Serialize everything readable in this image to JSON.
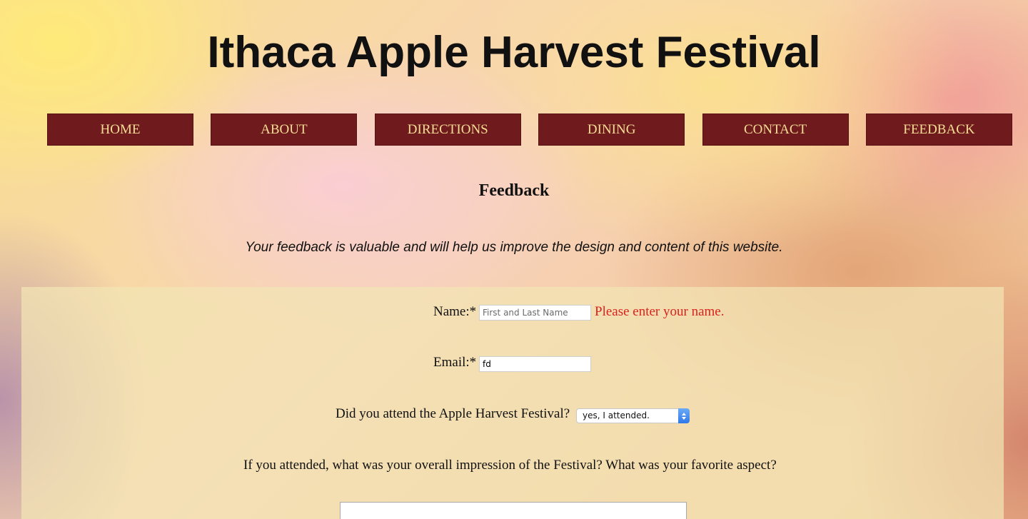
{
  "site": {
    "title": "Ithaca Apple Harvest Festival"
  },
  "nav": {
    "items": [
      {
        "label": "HOME"
      },
      {
        "label": "ABOUT"
      },
      {
        "label": "DIRECTIONS"
      },
      {
        "label": "DINING"
      },
      {
        "label": "CONTACT"
      },
      {
        "label": "FEEDBACK"
      }
    ]
  },
  "page": {
    "heading": "Feedback",
    "intro": "Your feedback is valuable and will help us improve the design and content of this website."
  },
  "form": {
    "name": {
      "label": "Name:*",
      "placeholder": "First and Last Name",
      "value": "",
      "error": "Please enter your name."
    },
    "email": {
      "label": "Email:*",
      "value": "fd"
    },
    "attended": {
      "label": "Did you attend the Apple Harvest Festival?",
      "selected": "yes, I attended."
    },
    "impression": {
      "label": "If you attended, what was your overall impression of the Festival? What was your favorite aspect?"
    }
  },
  "colors": {
    "nav_background": "#6f1a1c",
    "nav_text": "#f6de96",
    "error_text": "#d8231e",
    "select_arrow": "#2f79e8"
  }
}
